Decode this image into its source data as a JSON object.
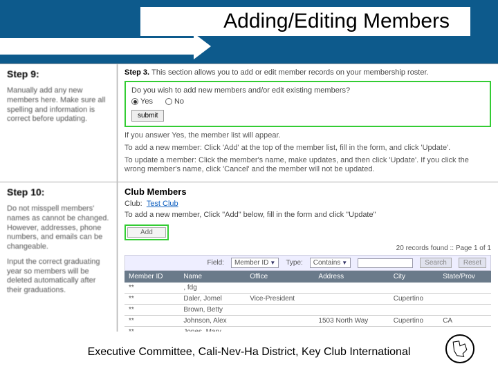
{
  "title": "Adding/Editing Members",
  "step9": {
    "heading": "Step 9:",
    "text": "Manually add any new members here. Make sure all spelling and information is correct before updating.",
    "stepline_b": "Step 3.",
    "stepline_rest": "This section allows you to add or edit member records on your membership roster.",
    "question": "Do you wish to add new members and/or edit existing members?",
    "yes": "Yes",
    "no": "No",
    "submit": "submit",
    "instr1": "If you answer Yes, the member list will appear.",
    "instr2": "To add a new member:  Click 'Add' at the top of the member list, fill in the form, and click 'Update'.",
    "instr3": "To update a member:  Click the member's name, make updates, and then click 'Update'. If you click the wrong member's name, click 'Cancel' and the member will not be updated."
  },
  "step10": {
    "heading": "Step 10:",
    "text1": "Do not misspell members' names as cannot be changed. However, addresses, phone numbers, and emails can be changeable.",
    "text2": "Input the correct graduating year so members will be deleted automatically after their graduations.",
    "club_title": "Club Members",
    "club_label": "Club:",
    "club_name": "Test Club",
    "club_instr": "To add a new member, Click \"Add\" below, fill in the form and click \"Update\"",
    "add_label": "Add",
    "records": "20 records found :: Page 1 of 1",
    "field_label": "Field:",
    "field_value": "Member ID",
    "type_label": "Type:",
    "type_value": "Contains",
    "search": "Search",
    "reset": "Reset"
  },
  "table": {
    "headers": [
      "Member ID",
      "Name",
      "Office",
      "Address",
      "City",
      "State/Prov"
    ],
    "rows": [
      {
        "id": "**",
        "name": ", fdg",
        "office": "",
        "address": "",
        "city": "",
        "state": ""
      },
      {
        "id": "**",
        "name": "Daler, Jomel",
        "office": "Vice-President",
        "address": "",
        "city": "Cupertino",
        "state": ""
      },
      {
        "id": "**",
        "name": "Brown, Betty",
        "office": "",
        "address": "",
        "city": "",
        "state": ""
      },
      {
        "id": "**",
        "name": "Johnson, Alex",
        "office": "",
        "address": "1503 North Way",
        "city": "Cupertino",
        "state": "CA"
      },
      {
        "id": "**",
        "name": "Jones, Mary",
        "office": "",
        "address": "",
        "city": "",
        "state": ""
      }
    ]
  },
  "footer": "Executive Committee, Cali-Nev-Ha District, Key Club International",
  "chart_data": {
    "type": "table",
    "title": "Club Members",
    "columns": [
      "Member ID",
      "Name",
      "Office",
      "Address",
      "City",
      "State/Prov"
    ],
    "rows": [
      [
        "**",
        ", fdg",
        "",
        "",
        "",
        ""
      ],
      [
        "**",
        "Daler, Jomel",
        "Vice-President",
        "",
        "Cupertino",
        ""
      ],
      [
        "**",
        "Brown, Betty",
        "",
        "",
        "",
        ""
      ],
      [
        "**",
        "Johnson, Alex",
        "",
        "1503 North Way",
        "Cupertino",
        "CA"
      ],
      [
        "**",
        "Jones, Mary",
        "",
        "",
        "",
        ""
      ]
    ],
    "records_found": 20,
    "page": "1 of 1"
  }
}
